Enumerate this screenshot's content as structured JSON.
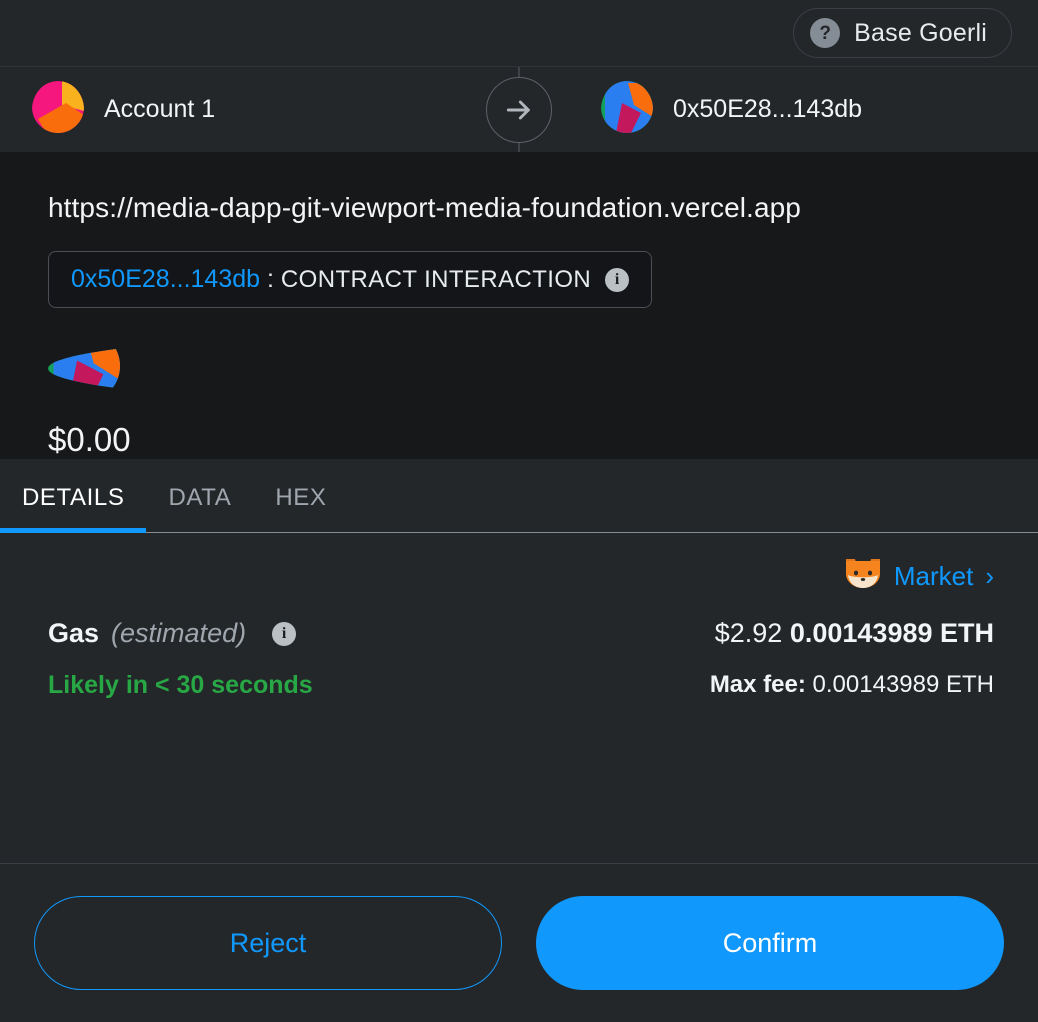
{
  "header": {
    "network_name": "Base Goerli",
    "network_badge_glyph": "?"
  },
  "accounts": {
    "from_name": "Account 1",
    "to_name": "0x50E28...143db",
    "arrow_glyph": "→"
  },
  "origin": {
    "site_url": "https://media-dapp-git-viewport-media-foundation.vercel.app",
    "contract_address": "0x50E28...143db",
    "separator": " : ",
    "interaction_type": "CONTRACT INTERACTION",
    "info_glyph": "i"
  },
  "amount": {
    "value": "$0.00"
  },
  "tabs": [
    {
      "label": "DETAILS",
      "active": true
    },
    {
      "label": "DATA",
      "active": false
    },
    {
      "label": "HEX",
      "active": false
    }
  ],
  "details": {
    "market_label": "Market",
    "market_chevron": "›",
    "gas_label": "Gas",
    "gas_estimated": "(estimated)",
    "gas_info_glyph": "i",
    "gas_speed": "Likely in < 30 seconds",
    "gas_fiat": "$2.92",
    "gas_eth": "0.00143989 ETH",
    "max_fee_label": "Max fee:",
    "max_fee_value": "0.00143989 ETH"
  },
  "footer": {
    "reject_label": "Reject",
    "confirm_label": "Confirm"
  },
  "colors": {
    "accent_blue": "#1098fc",
    "success_green": "#28a745",
    "panel": "#24272a",
    "body": "#16181a"
  }
}
